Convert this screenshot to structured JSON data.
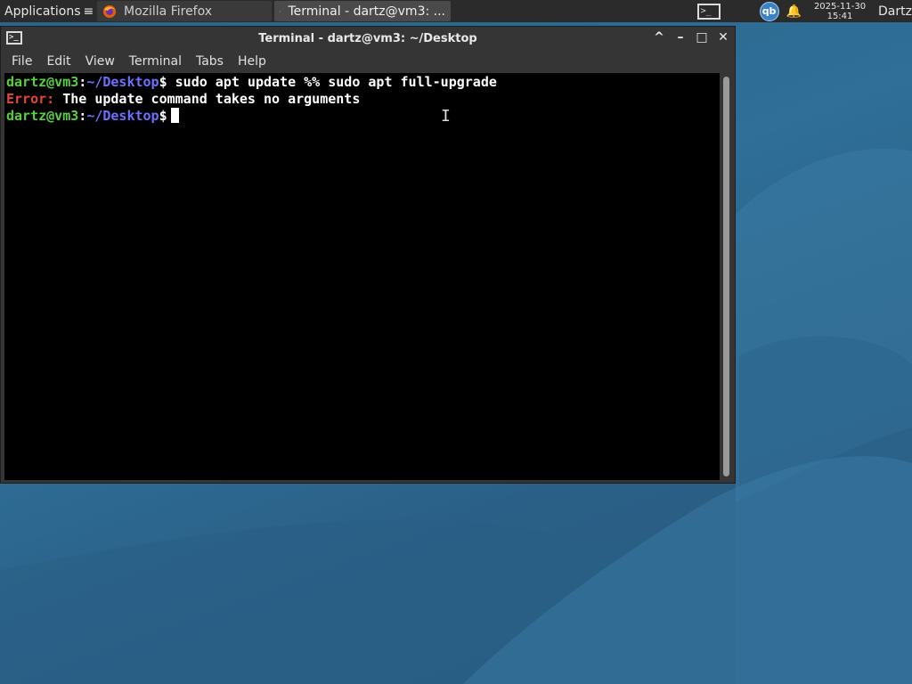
{
  "panel": {
    "applications_label": "Applications",
    "tasks": [
      {
        "label": "Mozilla Firefox",
        "icon": "firefox-icon"
      },
      {
        "label": "Terminal - dartz@vm3: ...",
        "icon": "terminal-icon"
      }
    ],
    "clock_date": "2025-11-30",
    "clock_time": "15:41",
    "user": "Dartz",
    "qb_label": "qb"
  },
  "window": {
    "title": "Terminal - dartz@vm3: ~/Desktop",
    "icon_glyph": ">_",
    "controls": {
      "keep_above": "^",
      "minimize": "–",
      "maximize": "□",
      "close": "✕"
    }
  },
  "menu": [
    "File",
    "Edit",
    "View",
    "Terminal",
    "Tabs",
    "Help"
  ],
  "terminal": {
    "prompt_user": "dartz@vm3",
    "prompt_sep": ":",
    "prompt_path": "~/Desktop",
    "prompt_symbol": "$",
    "command_1": " sudo apt update %% sudo apt full-upgrade",
    "error_label": "Error:",
    "error_message": " The update command takes no arguments"
  },
  "colors": {
    "prompt_user": "#55d13a",
    "prompt_path": "#6f6fff",
    "error": "#e8443a",
    "desktop": "#2f6d94"
  }
}
